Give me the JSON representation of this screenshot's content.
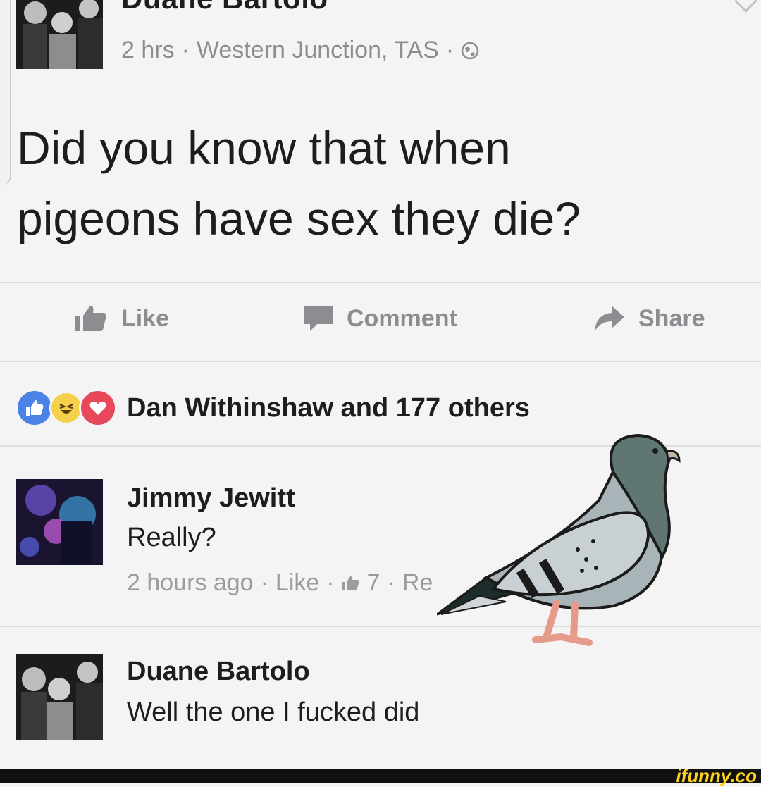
{
  "post": {
    "author": "Duane Bartolo",
    "time": "2 hrs",
    "separator": "·",
    "location": "Western Junction, TAS",
    "audience_icon": "globe-icon",
    "text_line1": "Did you know that when",
    "text_line2": "pigeons have sex they die?"
  },
  "actions": {
    "like": "Like",
    "comment": "Comment",
    "share": "Share"
  },
  "reactions": {
    "icons": [
      "like-reaction-icon",
      "haha-reaction-icon",
      "love-reaction-icon"
    ],
    "summary": "Dan Withinshaw and 177 others"
  },
  "comments": [
    {
      "name": "Jimmy Jewitt",
      "text": "Really?",
      "time": "2 hours ago",
      "like_label": "Like",
      "like_count": "7",
      "reply_label": "Re"
    },
    {
      "name": "Duane Bartolo",
      "text": "Well the one I fucked did"
    }
  ],
  "watermark": "ifunny.co",
  "colors": {
    "background": "#f4f4f5",
    "text": "#1d1d1f",
    "muted": "#8b8d91",
    "like_blue": "#4a82e8",
    "love_red": "#e8485a",
    "haha_yellow": "#f5d04a"
  }
}
